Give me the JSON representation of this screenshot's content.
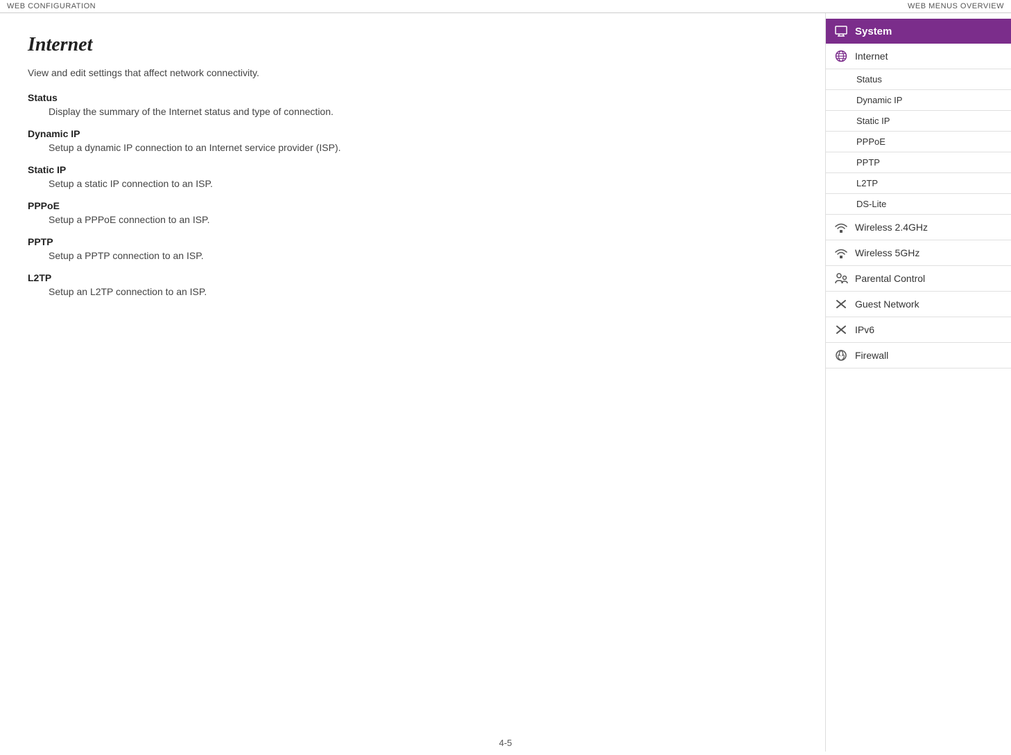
{
  "header": {
    "left_label": "Web Configuration",
    "right_label": "Web Menus Overview"
  },
  "page": {
    "title": "Internet",
    "intro": "View and edit settings that affect network connectivity.",
    "sections": [
      {
        "heading": "Status",
        "body": "Display the summary of the Internet status and type of connection."
      },
      {
        "heading": "Dynamic IP",
        "body": "Setup a dynamic IP connection to an Internet service provider (ISP)."
      },
      {
        "heading": "Static IP",
        "body": "Setup a static IP connection to an ISP."
      },
      {
        "heading": "PPPoE",
        "body": "Setup a PPPoE connection to an ISP."
      },
      {
        "heading": "PPTP",
        "body": "Setup a PPTP connection to an ISP."
      },
      {
        "heading": "L2TP",
        "body": "Setup an L2TP connection to an ISP."
      }
    ]
  },
  "footer": {
    "page_number": "4-5"
  },
  "sidebar": {
    "system_label": "System",
    "internet_label": "Internet",
    "sub_items": [
      "Status",
      "Dynamic IP",
      "Static IP",
      "PPPoE",
      "PPTP",
      "L2TP",
      "DS-Lite"
    ],
    "main_items": [
      {
        "label": "Wireless 2.4GHz",
        "icon": "wireless-icon"
      },
      {
        "label": "Wireless 5GHz",
        "icon": "wireless-icon"
      },
      {
        "label": "Parental Control",
        "icon": "parental-icon"
      },
      {
        "label": "Guest Network",
        "icon": "x-icon"
      },
      {
        "label": "IPv6",
        "icon": "x-icon"
      },
      {
        "label": "Firewall",
        "icon": "firewall-icon"
      }
    ]
  }
}
